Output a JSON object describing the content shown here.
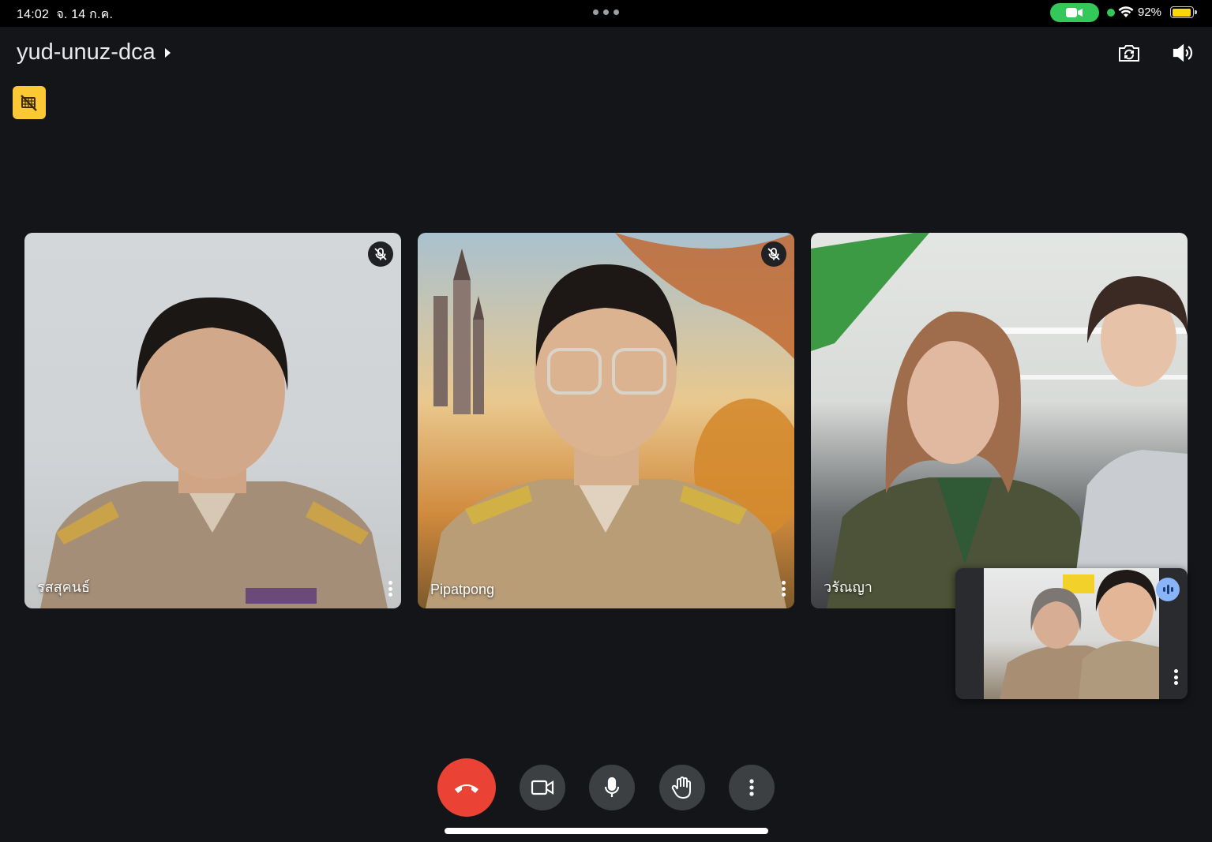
{
  "status_bar": {
    "time": "14:02",
    "date": "จ. 14 ก.ค.",
    "battery": "92%",
    "battery_level": 0.92,
    "camera_indicator_color": "#34c759",
    "icons": [
      "more-dots-icon",
      "camera-in-use-icon",
      "wifi-icon",
      "battery-icon"
    ]
  },
  "meeting": {
    "code": "yud-unuz-dca",
    "top_actions": [
      "switch-camera-icon",
      "speaker-volume-icon"
    ],
    "badge_icon": "no-recording-icon",
    "badge_color": "#fcc934"
  },
  "participants": [
    {
      "name": "รสสุคนธ์",
      "muted": true
    },
    {
      "name": "Pipatpong",
      "muted": true
    },
    {
      "name": "วรัณญา",
      "muted": false
    }
  ],
  "self_view": {
    "speaking_indicator_color": "#8ab4f8"
  },
  "controls": {
    "end_call_color": "#ea4335",
    "buttons": [
      "end-call-icon",
      "camera-icon",
      "microphone-icon",
      "raise-hand-icon",
      "more-options-icon"
    ]
  }
}
